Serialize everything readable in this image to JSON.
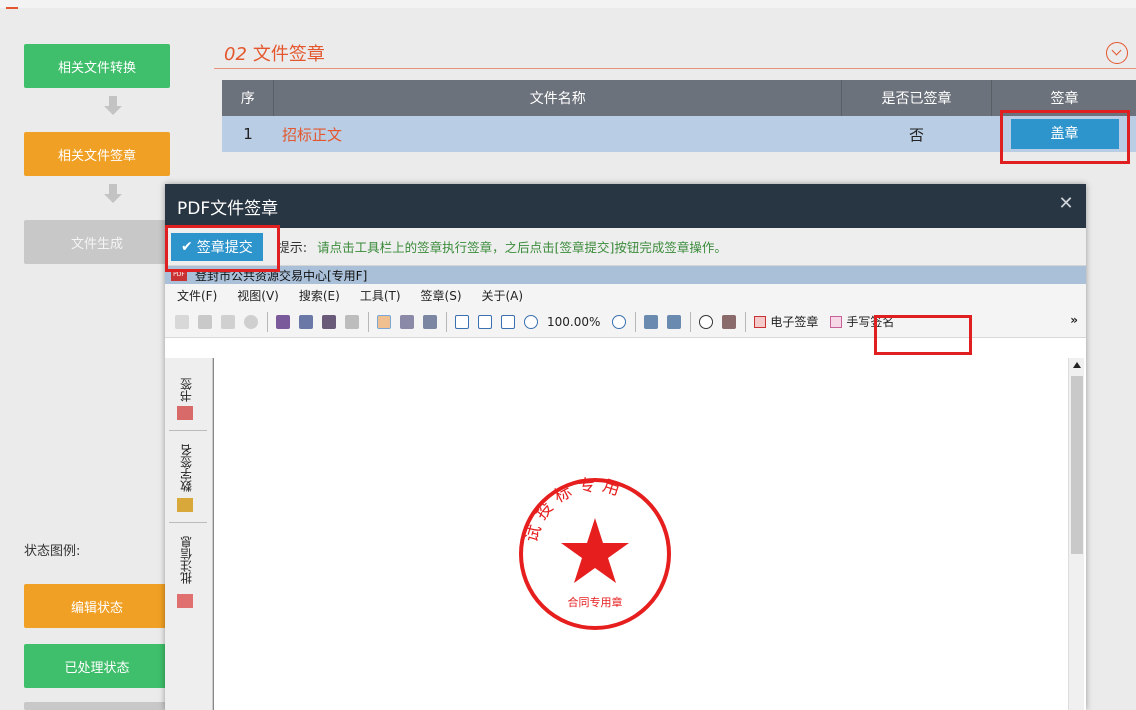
{
  "flow": {
    "step1": "相关文件转换",
    "step2": "相关文件签章",
    "step3": "文件生成"
  },
  "legend": {
    "label": "状态图例:",
    "editing": "编辑状态",
    "processed": "已处理状态"
  },
  "section": {
    "number": "02",
    "title": "文件签章"
  },
  "table": {
    "headers": {
      "seq": "序",
      "name": "文件名称",
      "signed": "是否已签章",
      "action": "签章"
    },
    "rows": [
      {
        "seq": "1",
        "name": "招标正文",
        "signed": "否",
        "action": "盖章"
      }
    ]
  },
  "dialog": {
    "title": "PDF文件签章",
    "submit_label": "签章提交",
    "hint_label": "提示:",
    "hint_text": "请点击工具栏上的签章执行签章，之后点击[签章提交]按钮完成签章操作。",
    "doc_name": "登封市公共资源交易中心[专用F]",
    "menu": [
      "文件(F)",
      "视图(V)",
      "搜索(E)",
      "工具(T)",
      "签章(S)",
      "关于(A)"
    ],
    "zoom": "100.00%",
    "e_seal": "电子签章",
    "handwrite": "手写签名",
    "side_tabs": {
      "bookmark": "书签",
      "digital_sign": "数字签名",
      "annotation": "批注信息"
    }
  },
  "seal": {
    "arc_text": "试投标专用",
    "bottom_text": "合同专用章"
  },
  "colors": {
    "accent": "#e4572e",
    "green": "#3fbf6b",
    "orange": "#f0a024",
    "blue": "#2e94cc",
    "highlight": "#e02020"
  }
}
